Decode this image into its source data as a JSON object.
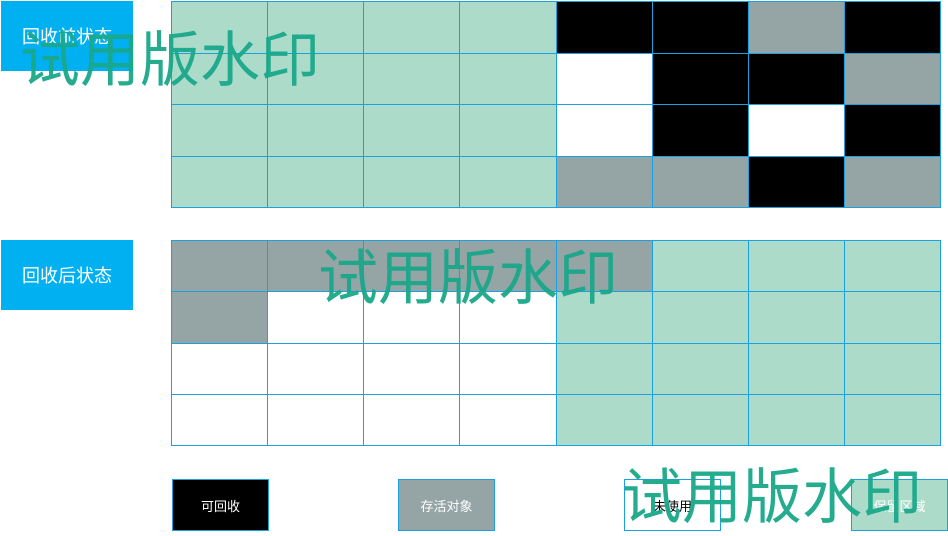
{
  "labels": {
    "before": "回收前状态",
    "after": "回收后状态"
  },
  "colors": {
    "reclaimable": "#000000",
    "alive": "#95a5a6",
    "unused": "#ffffff",
    "reserved": "#acdbc9",
    "label_bg": "#00b0f0",
    "border": "#1aa1e0"
  },
  "grids": {
    "before": [
      [
        "reserved",
        "reserved",
        "reserved",
        "reserved",
        "reclaimable",
        "reclaimable",
        "alive",
        "reclaimable"
      ],
      [
        "reserved",
        "reserved",
        "reserved",
        "reserved",
        "unused",
        "reclaimable",
        "reclaimable",
        "alive"
      ],
      [
        "reserved",
        "reserved",
        "reserved",
        "reserved",
        "unused",
        "reclaimable",
        "unused",
        "reclaimable"
      ],
      [
        "reserved",
        "reserved",
        "reserved",
        "reserved",
        "alive",
        "alive",
        "reclaimable",
        "alive"
      ]
    ],
    "after": [
      [
        "alive",
        "alive",
        "alive",
        "alive",
        "alive",
        "reserved",
        "reserved",
        "reserved"
      ],
      [
        "alive",
        "unused",
        "unused",
        "unused",
        "reserved",
        "reserved",
        "reserved",
        "reserved"
      ],
      [
        "unused",
        "unused",
        "unused",
        "unused",
        "reserved",
        "reserved",
        "reserved",
        "reserved"
      ],
      [
        "unused",
        "unused",
        "unused",
        "unused",
        "reserved",
        "reserved",
        "reserved",
        "reserved"
      ]
    ]
  },
  "legend": {
    "reclaimable": "可回收",
    "alive": "存活对象",
    "unused": "未使用",
    "reserved": "保留区域"
  },
  "watermark": "试用版水印"
}
